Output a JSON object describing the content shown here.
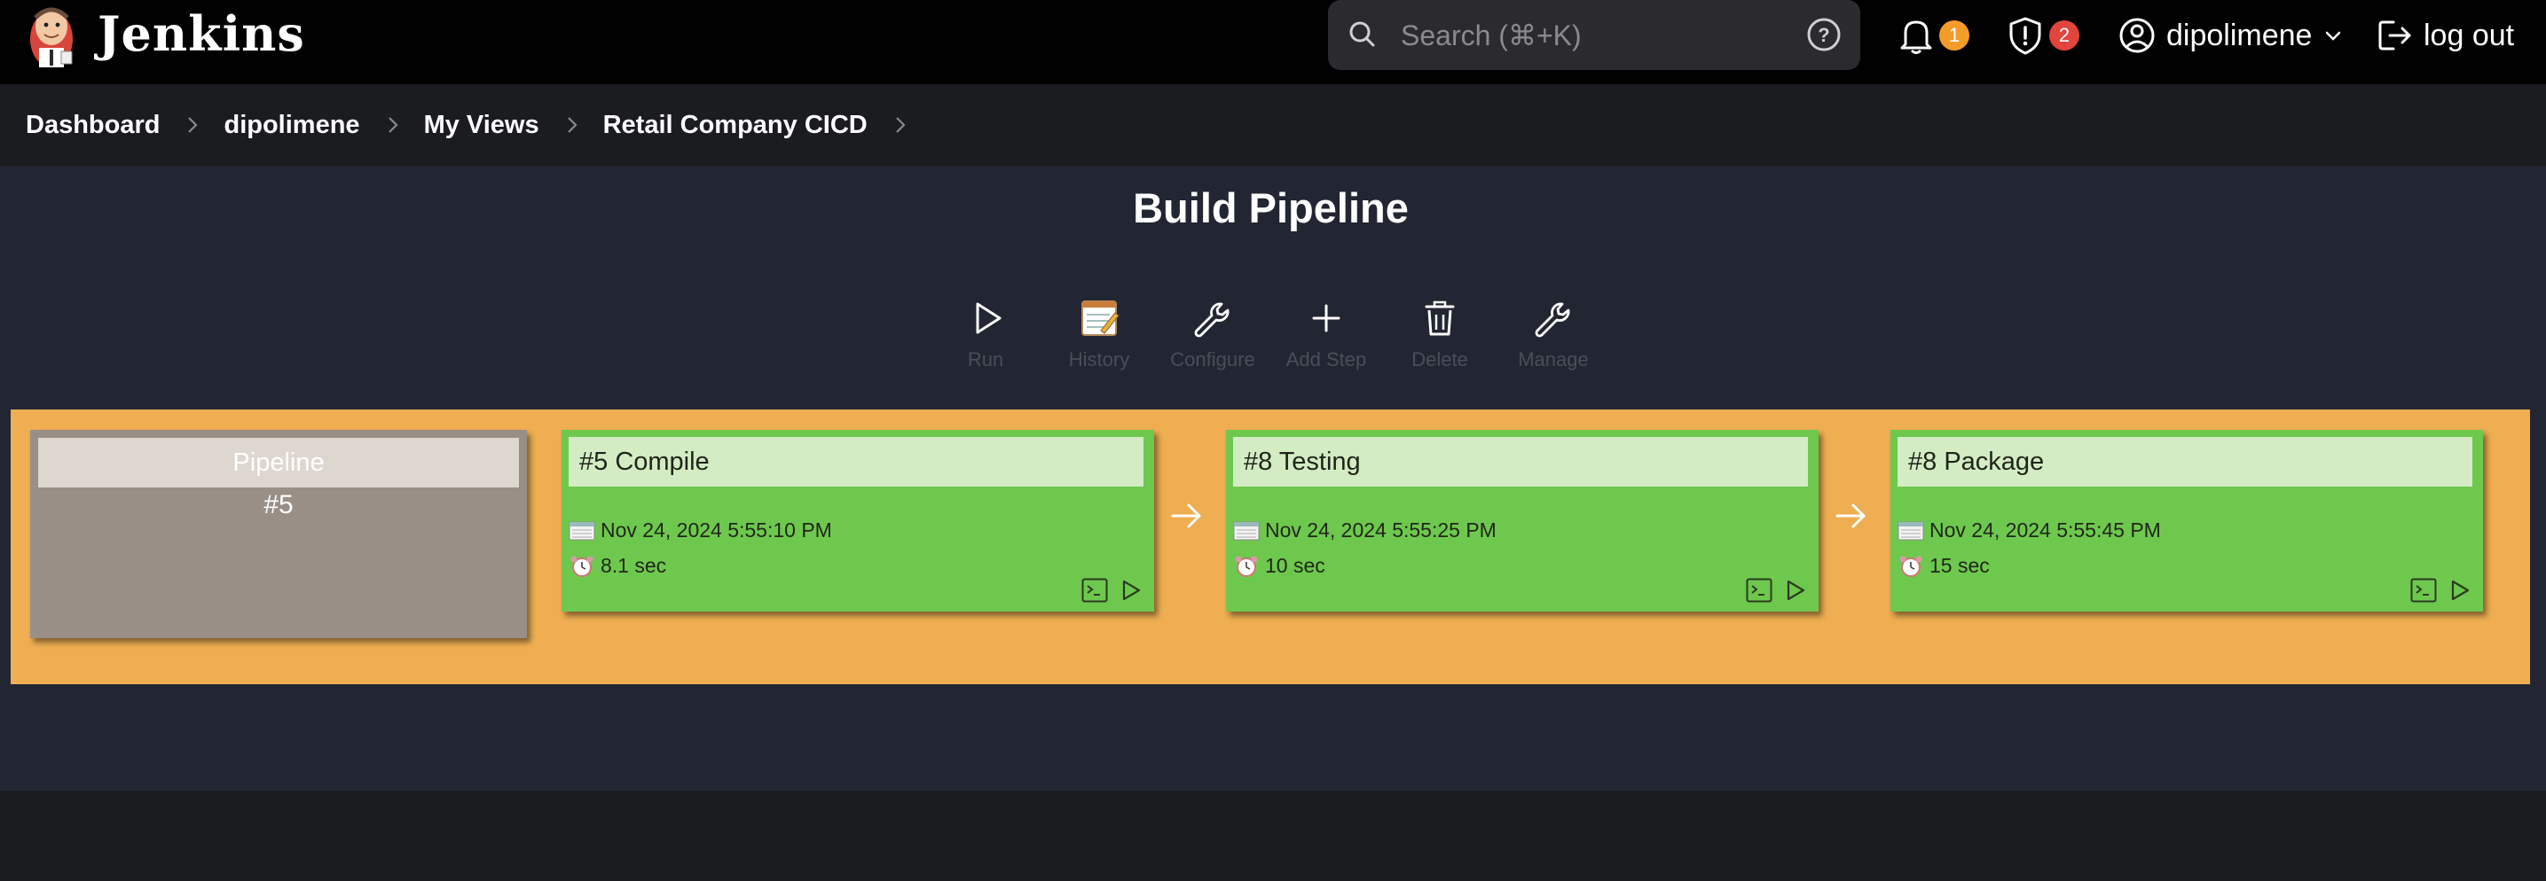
{
  "header": {
    "brand": "Jenkins",
    "search_placeholder": "Search (⌘+K)",
    "notifications_count": "1",
    "security_count": "2",
    "username": "dipolimene",
    "logout_label": "log out",
    "colors": {
      "background": "#000000",
      "notification_badge": "#f49c2a",
      "security_badge": "#e2453c"
    }
  },
  "breadcrumb": [
    "Dashboard",
    "dipolimene",
    "My Views",
    "Retail Company CICD"
  ],
  "page": {
    "title": "Build Pipeline"
  },
  "toolbar": {
    "run": "Run",
    "history": "History",
    "configure": "Configure",
    "add_step": "Add Step",
    "delete": "Delete",
    "manage": "Manage"
  },
  "pipeline": {
    "header_label": "Pipeline",
    "header_number": "#5",
    "stages": [
      {
        "title": "#5 Compile",
        "date": "Nov 24, 2024 5:55:10 PM",
        "duration": "8.1 sec"
      },
      {
        "title": "#8 Testing",
        "date": "Nov 24, 2024 5:55:25 PM",
        "duration": "10 sec"
      },
      {
        "title": "#8 Package",
        "date": "Nov 24, 2024 5:55:45 PM",
        "duration": "15 sec"
      }
    ],
    "colors": {
      "band": "#efae52",
      "stage_success": "#6ec84e",
      "stage_title_bg": "#d3ecc4",
      "header_card": "#998f86"
    }
  }
}
